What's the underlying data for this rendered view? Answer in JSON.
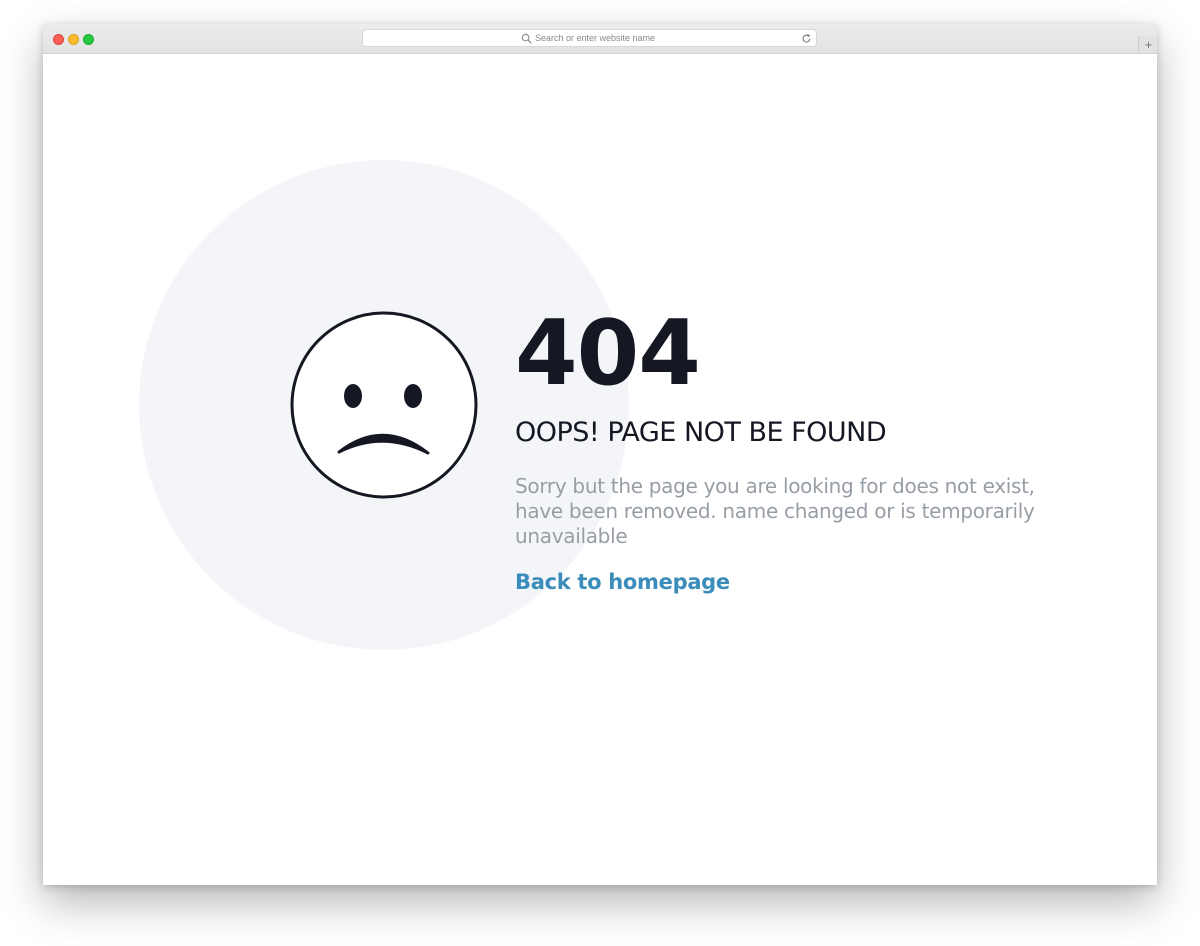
{
  "browser": {
    "url_placeholder": "Search or enter website name",
    "new_tab_label": "+"
  },
  "error": {
    "code": "404",
    "heading": "OOPS! PAGE NOT BE FOUND",
    "message": "Sorry but the page you are looking for does not exist, have been removed. name changed or is temporarily unavailable",
    "home_link": "Back to homepage"
  },
  "icons": {
    "face": "sad-face-icon",
    "search": "search-icon",
    "reload": "reload-icon"
  },
  "colors": {
    "primary_text": "#151723",
    "muted_text": "#979ea6",
    "link": "#3a8dbb",
    "circle_bg": "#f3f5f8"
  }
}
